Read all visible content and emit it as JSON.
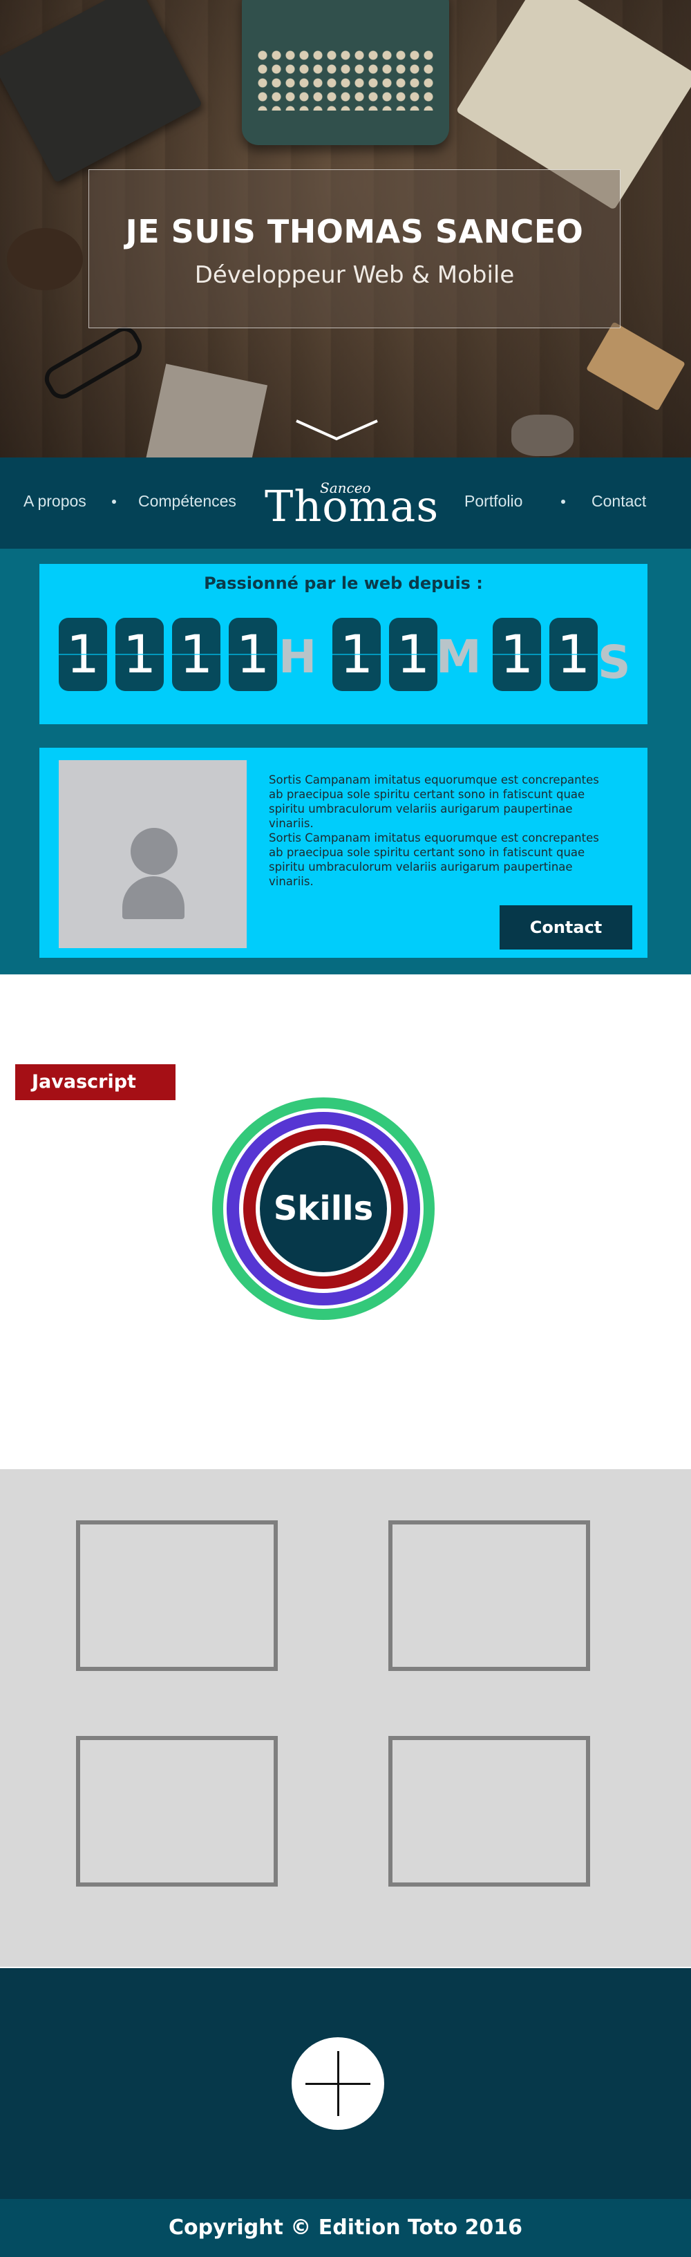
{
  "hero": {
    "title": "JE SUIS THOMAS SANCEO",
    "subtitle": "Développeur Web & Mobile"
  },
  "nav": {
    "items": [
      {
        "label": "A propos"
      },
      {
        "label": "Compétences"
      },
      {
        "label": "Portfolio"
      },
      {
        "label": "Contact"
      }
    ],
    "logo_small": "Sanceo",
    "logo_big": "Thomas"
  },
  "counter": {
    "title": "Passionné par le web depuis :",
    "hours_digits": [
      "1",
      "1",
      "1",
      "1"
    ],
    "hours_unit": "H",
    "minutes_digits": [
      "1",
      "1"
    ],
    "minutes_unit": "M",
    "seconds_digits": [
      "1",
      "1"
    ],
    "seconds_unit": "S"
  },
  "about": {
    "paragraphs": [
      "Sortis Campanam imitatus equorumque est concrepantes ab praecipua sole spiritu certant sono in fatiscunt quae spiritu umbraculorum velariis aurigarum paupertinae vinariis.",
      "Sortis Campanam imitatus equorumque est concrepantes ab praecipua sole spiritu certant sono in fatiscunt quae spiritu umbraculorum velariis aurigarum paupertinae vinariis."
    ],
    "contact_label": "Contact"
  },
  "skills": {
    "tag_label": "Javascript",
    "center_label": "Skills",
    "ring_colors": [
      "#33c97a",
      "#5636d3",
      "#a50f15"
    ]
  },
  "portfolio": {
    "items": 4
  },
  "footer": {
    "plus_icon": "plus-icon",
    "copyright": "Copyright  © Edition Toto 2016"
  },
  "colors": {
    "nav_bg": "#044256",
    "accent_cyan": "#00cdfb",
    "dark_teal": "#06384a",
    "band_teal": "#066b80",
    "skill_red": "#a50f15"
  }
}
